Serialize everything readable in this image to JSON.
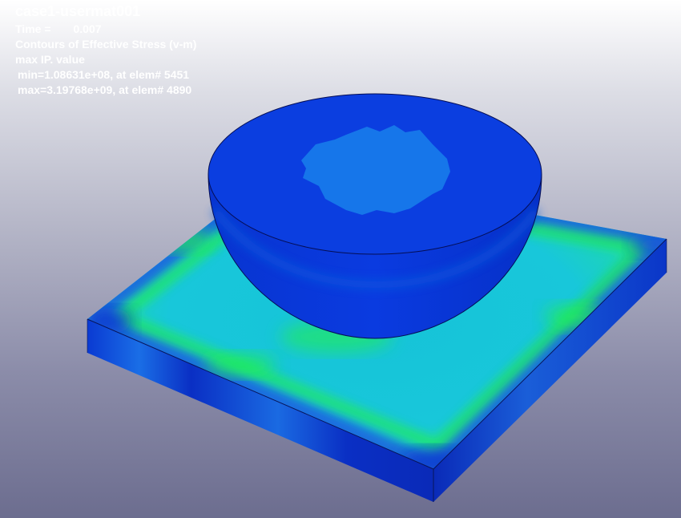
{
  "viewer": {
    "case_title": "case1-usermat001",
    "time_label": "Time =",
    "time_value": "0.007",
    "contour_label": "Contours of Effective Stress (v-m)",
    "value_mode": "max IP. value",
    "min_text": "min=1.08631e+08, at elem# 5451",
    "max_text": "max=3.19768e+09, at elem# 4890"
  },
  "contour_colors": {
    "plate_top": "#17c6d8",
    "plate_hot": "#20e86a",
    "plate_edge": "#1a6fe0",
    "plate_side": "#0a2fc4",
    "punch_top": "#0b3ee0",
    "punch_center": "#1574ea",
    "punch_side": "#0833d4",
    "punch_band": "#0a55dd"
  }
}
